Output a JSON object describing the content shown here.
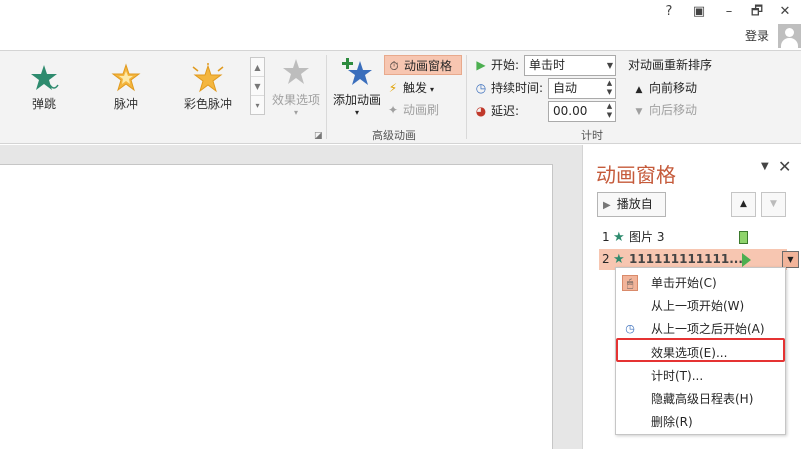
{
  "window": {
    "help_label": "?",
    "restore_label": "▣",
    "minimize_label": "–",
    "maximize_label": "🗗",
    "close_label": "✕",
    "login": "登录"
  },
  "ribbon": {
    "gallery": [
      "弹跳",
      "脉冲",
      "彩色脉冲"
    ],
    "effect_options": "效果选项",
    "add_animation": "添加动画",
    "animation_pane": "动画窗格",
    "trigger": "触发",
    "animation_painter": "动画刷",
    "advanced_group": "高级动画",
    "start_label": "开始:",
    "start_value": "单击时",
    "duration_label": "持续时间:",
    "duration_value": "自动",
    "delay_label": "延迟:",
    "delay_value": "00.00",
    "reorder_title": "对动画重新排序",
    "move_earlier": "向前移动",
    "move_later": "向后移动",
    "timing_group": "计时"
  },
  "pane": {
    "title": "动画窗格",
    "play_from": "播放自",
    "rows": [
      {
        "index": "1",
        "name": "图片 3"
      },
      {
        "index": "2",
        "name": "111111111111...."
      }
    ]
  },
  "menu": {
    "items": [
      {
        "label": "单击开始(C)",
        "icon": "mouse-click-icon"
      },
      {
        "label": "从上一项开始(W)",
        "icon": ""
      },
      {
        "label": "从上一项之后开始(A)",
        "icon": "clock-icon"
      },
      {
        "label": "效果选项(E)...",
        "icon": ""
      },
      {
        "label": "计时(T)...",
        "icon": ""
      },
      {
        "label": "隐藏高级日程表(H)",
        "icon": ""
      },
      {
        "label": "删除(R)",
        "icon": ""
      }
    ]
  },
  "colors": {
    "accent": "#c55a3a",
    "selected_row": "#f7c6b1",
    "highlight_border": "#e53333",
    "star_green": "#2e8b6e"
  }
}
